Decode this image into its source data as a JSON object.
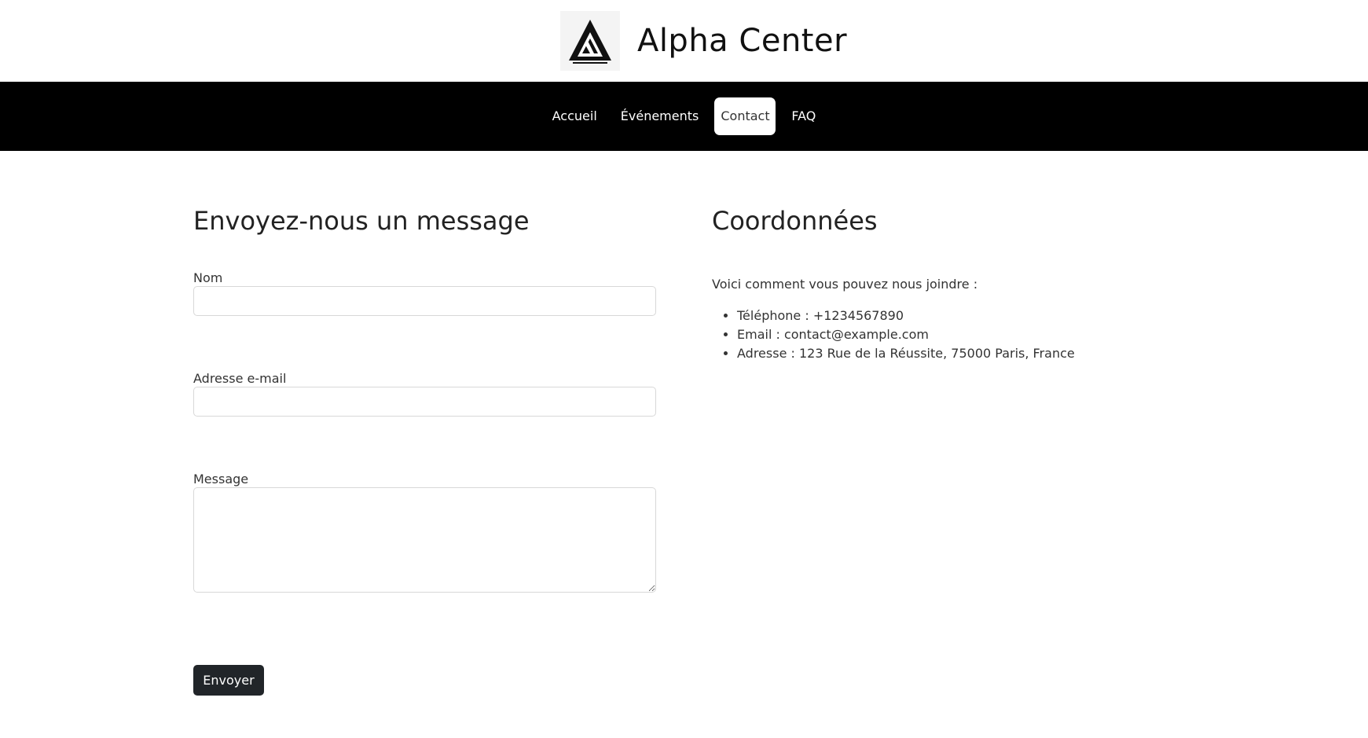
{
  "brand": {
    "name": "Alpha Center",
    "logo_icon": "triangle-logo-icon"
  },
  "nav": {
    "items": [
      {
        "label": "Accueil",
        "active": false
      },
      {
        "label": "Événements",
        "active": false
      },
      {
        "label": "Contact",
        "active": true
      },
      {
        "label": "FAQ",
        "active": false
      }
    ]
  },
  "form": {
    "title": "Envoyez-nous un message",
    "name_label": "Nom",
    "name_value": "",
    "email_label": "Adresse e-mail",
    "email_value": "",
    "message_label": "Message",
    "message_value": "",
    "submit_label": "Envoyer"
  },
  "contact_info": {
    "title": "Coordonnées",
    "intro": "Voici comment vous pouvez nous joindre :",
    "items": [
      "Téléphone : +1234567890",
      "Email : contact@example.com",
      "Adresse : 123 Rue de la Réussite, 75000 Paris, France"
    ]
  },
  "colors": {
    "navbar_bg": "#000000",
    "button_bg": "#212529",
    "active_nav_bg": "#ffffff"
  }
}
